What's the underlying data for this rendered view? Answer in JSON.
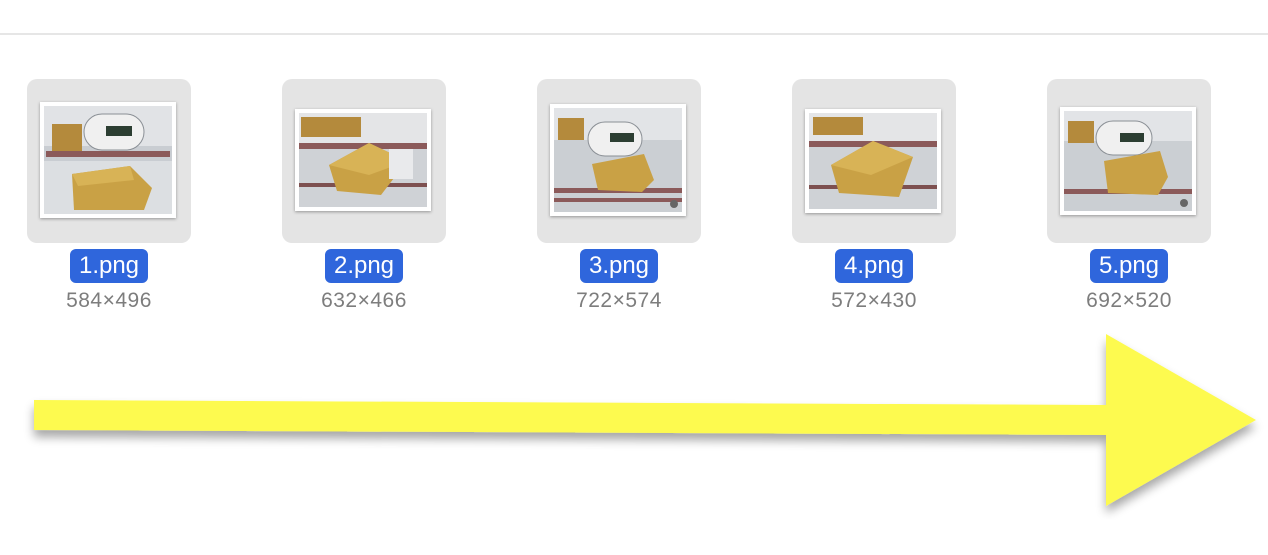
{
  "files": [
    {
      "name": "1.png",
      "dimensions": "584×496"
    },
    {
      "name": "2.png",
      "dimensions": "632×466"
    },
    {
      "name": "3.png",
      "dimensions": "722×574"
    },
    {
      "name": "4.png",
      "dimensions": "572×430"
    },
    {
      "name": "5.png",
      "dimensions": "692×520"
    }
  ],
  "colors": {
    "selection": "#2f66dc",
    "arrow": "#fdfa4f",
    "thumbnail_background": "#e4e4e4"
  },
  "icons": [
    "image-thumbnail-icon",
    "arrow-right-icon"
  ]
}
